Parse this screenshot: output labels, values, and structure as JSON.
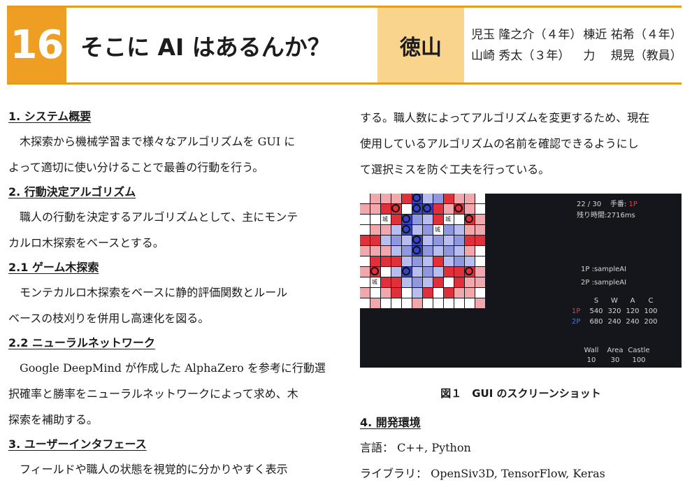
{
  "header": {
    "number": "16",
    "title": "そこに AI はあるんか？",
    "school": "徳山",
    "members": [
      [
        "児玉 隆之介（４年）",
        "棟近 祐希（４年）"
      ],
      [
        "山崎 秀太（３年）",
        "力　 規晃（教員）"
      ]
    ]
  },
  "left_column": {
    "s1_heading": "1.  システム概要",
    "s1_line1": "木探索から機械学習まで様々なアルゴリズムを GUI に",
    "s1_line2": "よって適切に使い分けることで最善の行動を行う。",
    "s2_heading": "2.  行動決定アルゴリズム",
    "s2_line1": "職人の行動を決定するアルゴリズムとして、主にモンテ",
    "s2_line2": "カルロ木探索をベースとする。",
    "s21_heading": "2.1   ゲーム木探索",
    "s21_line1": "モンテカルロ木探索をベースに静的評価関数とルール",
    "s21_line2": "ベースの枝刈りを併用し高速化を図る。",
    "s22_heading": "2.2   ニューラルネットワーク",
    "s22_line1": "Google DeepMind が作成した AlphaZero を参考に行動選",
    "s22_line2": "択確率と勝率をニューラルネットワークによって求め、木",
    "s22_line3": "探索を補助する。",
    "s3_heading": "3.  ユーザーインタフェース",
    "s3_line1": "フィールドや職人の状態を視覚的に分かりやすく表示"
  },
  "right_column": {
    "line1": "する。職人数によってアルゴリズムを変更するため、現在",
    "line2": "使用しているアルゴリズムの名前を確認できるようにし",
    "line3": "て選択ミスを防ぐ工夫を行っている。",
    "caption": "図１　GUI のスクリーンショット",
    "s4_heading": "4.   開発環境",
    "lang": "言語： C++,  Python",
    "lib": "ライブラリ： OpenSiv3D,  TensorFlow,  Keras"
  },
  "gui": {
    "turn": "22 / 30",
    "turn_label": "手番:",
    "turn_player": "1P",
    "time_left": "残り時間:2716ms",
    "p1_ai": "1P :sampleAI",
    "p2_ai": "2P :sampleAI",
    "castle_char": "城",
    "table_headers": [
      "S",
      "W",
      "A",
      "C"
    ],
    "table_rows": [
      {
        "label": "1P",
        "values": [
          "540",
          "320",
          "120",
          "100"
        ]
      },
      {
        "label": "2P",
        "values": [
          "680",
          "240",
          "240",
          "200"
        ]
      }
    ],
    "bottom_headers": [
      "Wall",
      "Area",
      "Castle"
    ],
    "bottom_values": [
      "10",
      "30",
      "100"
    ],
    "colors": {
      "red_wall": "#e0313a",
      "red_area": "#f0a8ad",
      "blue_wall": "#3545c8",
      "blue_area": "#a8b0e8",
      "neutral": "#ffffff",
      "pond": "#15151c"
    },
    "board": [
      "wrrrpBbbprrw",
      "rrpRwBBprRrw",
      "wwCpBbbpCwRr",
      "wrrbBbbCbbrr",
      "ppbbbBbbbbpp",
      "rrrbbBbbbbrw",
      "wpppbbbpbbbw",
      "rRwbBbbbppRr",
      "wCppbbbpwprr",
      "rwrpwbpwprrw",
      "wrwwwrwwwwwr"
    ]
  }
}
